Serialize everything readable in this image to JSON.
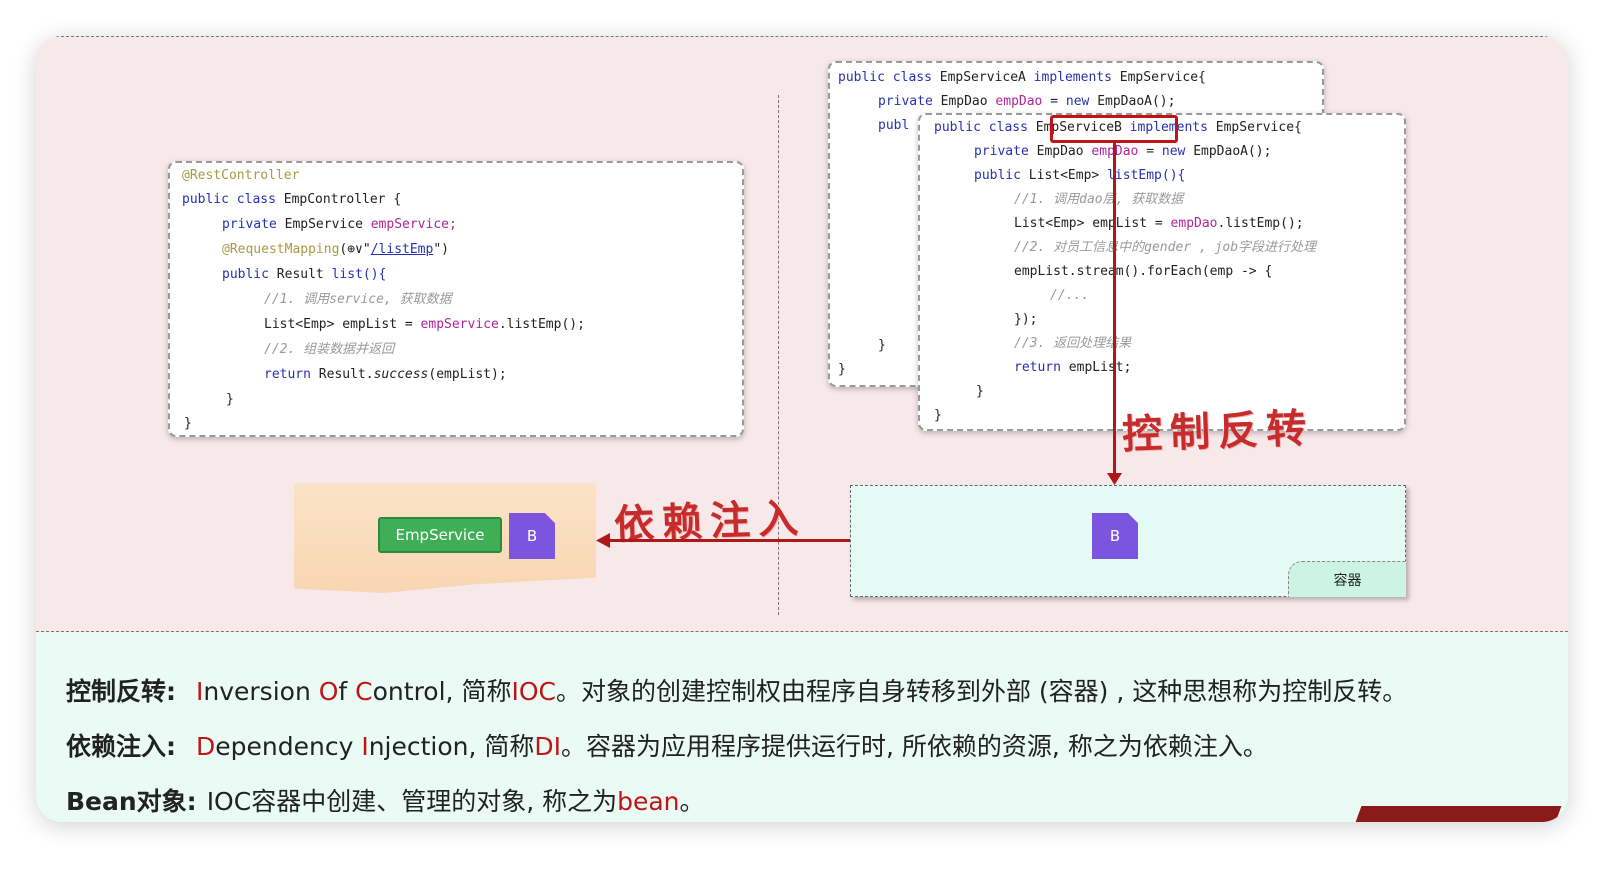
{
  "left_code": {
    "annotation": "@RestController",
    "class_line": [
      "public class ",
      "EmpController {"
    ],
    "field_line": [
      "private ",
      "EmpService ",
      "empService;"
    ],
    "mapping_line": [
      "@RequestMapping",
      "(⊕∨\"",
      "/listEmp",
      "\")"
    ],
    "method_line": [
      "public ",
      "Result ",
      "list(){"
    ],
    "comment1": "//1. 调用service, 获取数据",
    "list_line": [
      "List<Emp> empList = ",
      "empService",
      ".listEmp();"
    ],
    "comment2": "//2. 组装数据并返回",
    "return_line": [
      "return ",
      "Result.",
      "success",
      "(empList);"
    ],
    "close_inner": "}",
    "close_outer": "}"
  },
  "back_code": {
    "class_line": [
      "public class ",
      "EmpServiceA ",
      "implements ",
      "EmpService{"
    ],
    "field_line": [
      "private ",
      "EmpDao ",
      "empDao ",
      "= ",
      "new ",
      "EmpDaoA();"
    ],
    "method_line": "publ",
    "brace_inner": "}",
    "brace_outer": "}"
  },
  "front_code": {
    "class_line": [
      "public class ",
      "EmpServiceB",
      " implements ",
      "EmpService{"
    ],
    "field_line": [
      "private ",
      "EmpDao ",
      "empDao",
      " = ",
      "new ",
      "EmpDaoA();"
    ],
    "method_line": [
      "public ",
      "List<Emp> ",
      "listEmp(){"
    ],
    "comment1": "//1. 调用dao层, 获取数据",
    "list_line": [
      "List<Emp> empList = ",
      "empDao",
      ".listEmp();"
    ],
    "comment2": "//2. 对员工信息中的gender , job字段进行处理",
    "stream_line": "empList.stream().forEach(emp -> {",
    "comment_dots": "//...",
    "stream_close": "});",
    "comment3": "//3. 返回处理结果",
    "return_line": [
      "return ",
      "empList;"
    ],
    "close_inner": "}",
    "close_outer": "}"
  },
  "labels": {
    "ioc_handwritten": "控制反转",
    "di_handwritten": "依赖注入",
    "emp_service": "EmpService",
    "bean_left": "B",
    "bean_right": "B",
    "container": "容器"
  },
  "definitions": {
    "ioc": {
      "term": "控制反转:",
      "parts": [
        {
          "t": "I",
          "red": true
        },
        {
          "t": "nversion ",
          "red": false
        },
        {
          "t": "O",
          "red": true
        },
        {
          "t": "f ",
          "red": false
        },
        {
          "t": "C",
          "red": true
        },
        {
          "t": "ontrol, 简称",
          "red": false
        },
        {
          "t": "IOC",
          "red": true
        },
        {
          "t": "。对象的创建控制权由程序自身转移到外部 (容器) , 这种思想称为控制反转。",
          "red": false
        }
      ]
    },
    "di": {
      "term": "依赖注入:",
      "parts": [
        {
          "t": "D",
          "red": true
        },
        {
          "t": "ependency ",
          "red": false
        },
        {
          "t": "I",
          "red": true
        },
        {
          "t": "njection, 简称",
          "red": false
        },
        {
          "t": "DI",
          "red": true
        },
        {
          "t": "。容器为应用程序提供运行时, 所依赖的资源, 称之为依赖注入。",
          "red": false
        }
      ]
    },
    "bean": {
      "term": "Bean对象:",
      "parts": [
        {
          "t": "IOC容器中创建、管理的对象, 称之为",
          "red": false
        },
        {
          "t": "bean",
          "red": true
        },
        {
          "t": "。",
          "red": false
        }
      ]
    }
  },
  "colors": {
    "accent_red": "#c01515",
    "bean_purple": "#7b55e0",
    "empservice_green": "#3fae57",
    "container_bg": "#e4fbf6"
  }
}
